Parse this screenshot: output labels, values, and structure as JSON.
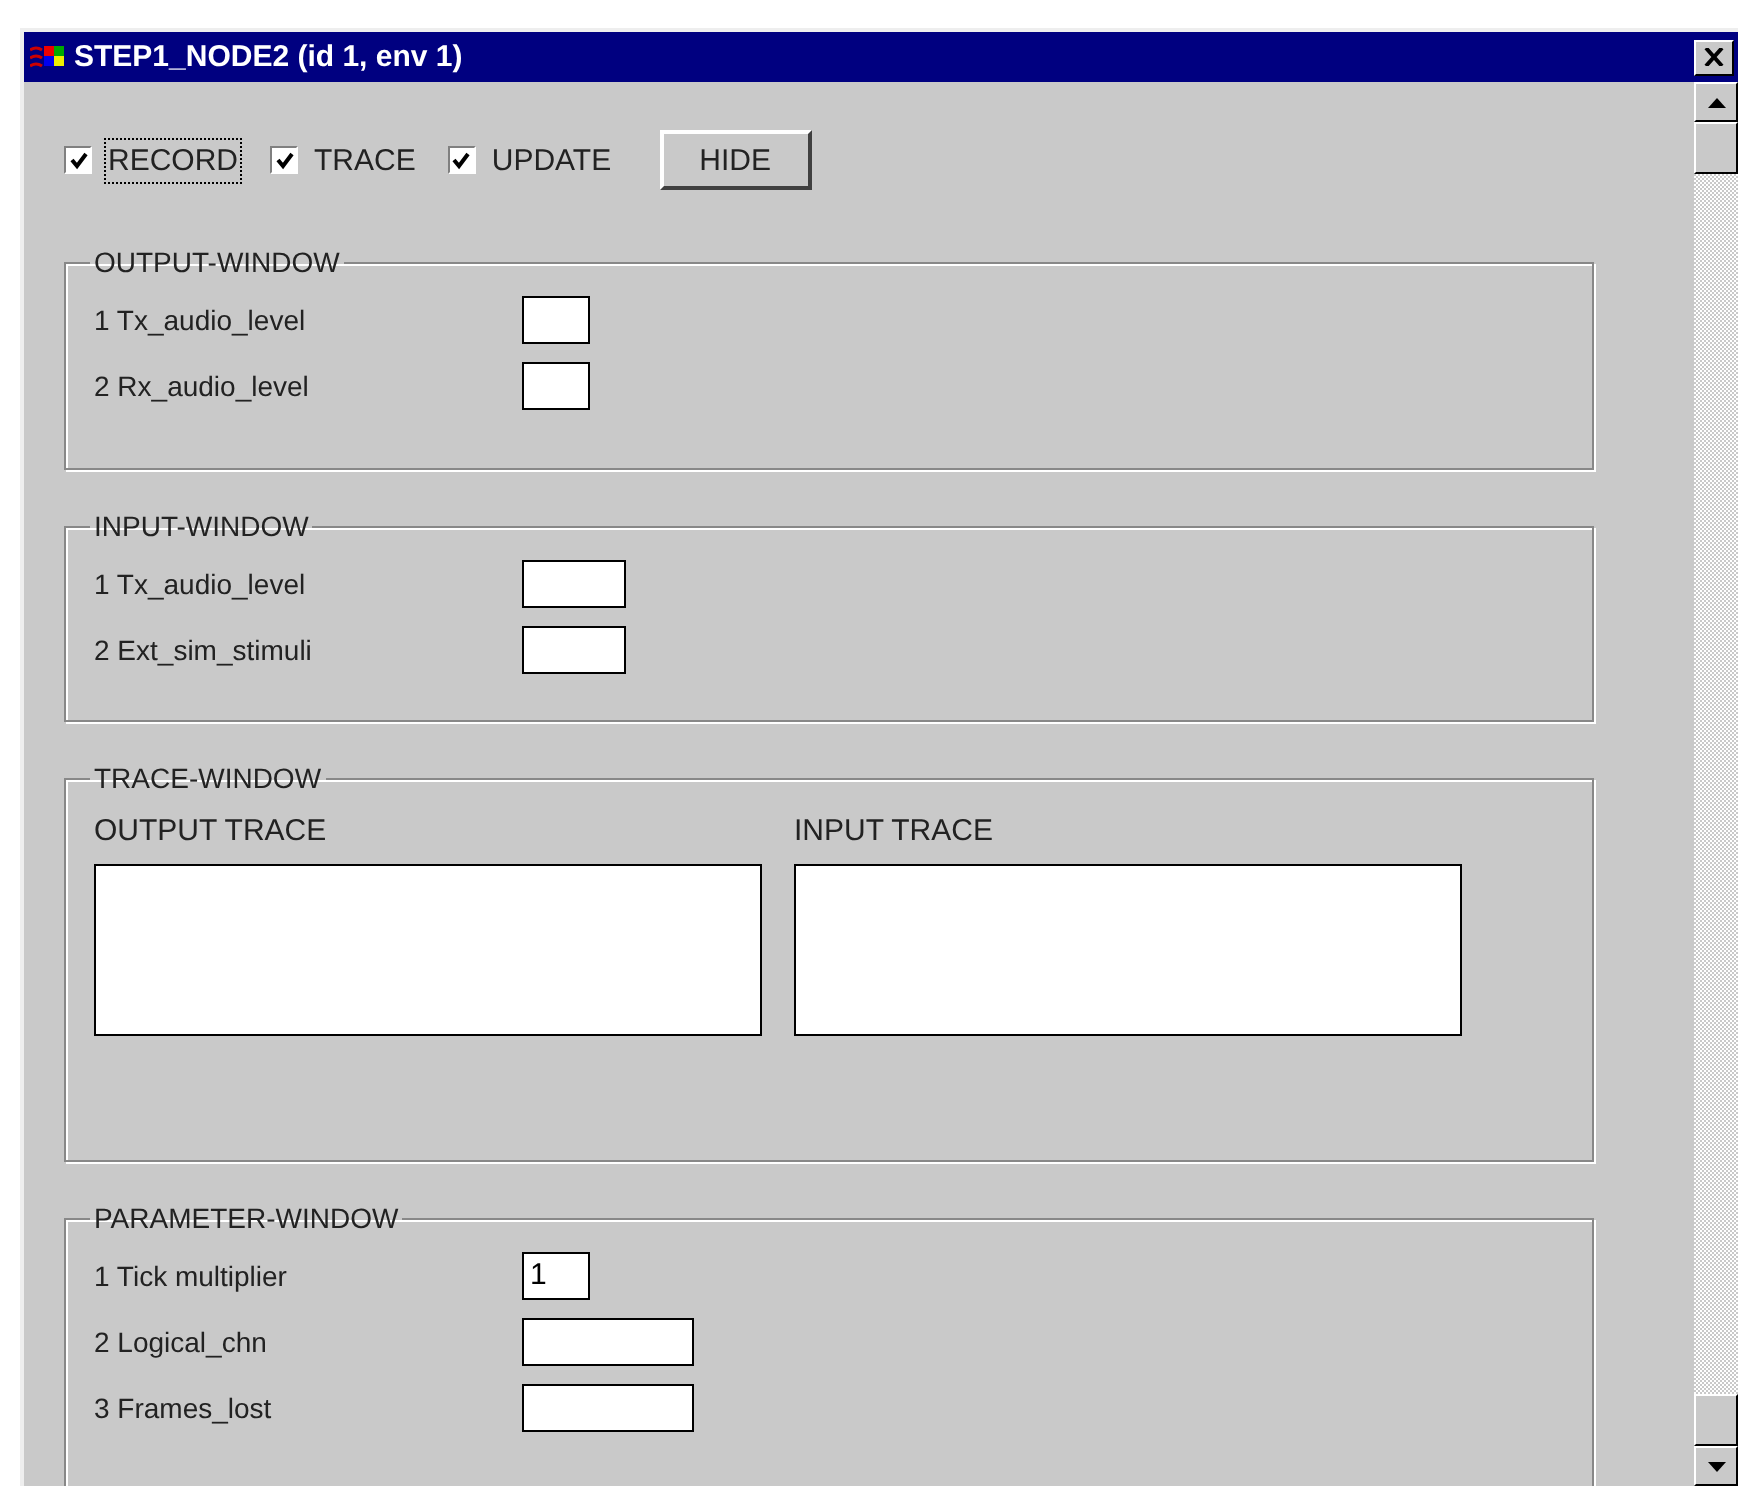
{
  "window": {
    "title": "STEP1_NODE2 (id 1, env 1)"
  },
  "toolbar": {
    "checkboxes": [
      {
        "label": "RECORD",
        "checked": true,
        "focused": true
      },
      {
        "label": "TRACE",
        "checked": true,
        "focused": false
      },
      {
        "label": "UPDATE",
        "checked": true,
        "focused": false
      }
    ],
    "button": "HIDE"
  },
  "output_window": {
    "title": "OUTPUT-WINDOW",
    "fields": [
      {
        "label": "1 Tx_audio_level",
        "kind": "short"
      },
      {
        "label": "2 Rx_audio_level",
        "kind": "short"
      }
    ]
  },
  "input_window": {
    "title": "INPUT-WINDOW",
    "fields": [
      {
        "label": "1 Tx_audio_level",
        "kind": "medium"
      },
      {
        "label": "2 Ext_sim_stimuli",
        "kind": "medium"
      }
    ]
  },
  "trace_window": {
    "title": "TRACE-WINDOW",
    "panes": [
      {
        "label": "OUTPUT TRACE"
      },
      {
        "label": "INPUT TRACE"
      }
    ]
  },
  "parameter_window": {
    "title": "PARAMETER-WINDOW",
    "fields": [
      {
        "label": "1 Tick multiplier",
        "kind": "short",
        "value": "1"
      },
      {
        "label": "2 Logical_chn",
        "kind": "long"
      },
      {
        "label": "3 Frames_lost",
        "kind": "long"
      }
    ]
  }
}
